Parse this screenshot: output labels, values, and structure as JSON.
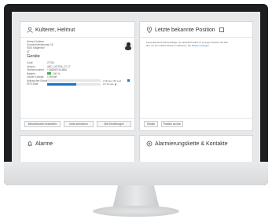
{
  "person_card": {
    "title": "Kulterer, Helmut",
    "address_lines": [
      "Helmut Kulterer",
      "Sonnenbuehlstrasse 18",
      "9020 Klagenfurt",
      "AT"
    ],
    "device_heading": "Geräte",
    "rows": [
      {
        "label": "Code",
        "value": "27780"
      },
      {
        "label": "Version",
        "value": "ABC-LX5TRA_27.17"
      },
      {
        "label": "Telefonnummer",
        "value": "+4368807344466"
      },
      {
        "label": "Batterie",
        "value": "100 %",
        "fill": 1.0
      },
      {
        "label": "Letzter Kontakt",
        "value": "1 Minute"
      },
      {
        "label": "Aktivsucher-Einstell.",
        "value": "2 Minuten (60 sec)",
        "fill": 0.75
      },
      {
        "label": "GPS-Rate",
        "value": "2/1 Stunde",
        "fill": 0.55
      }
    ],
    "buttons": [
      "Benutzerdaten bearbeiten",
      "Karte aufrufenen",
      "Alle Einstellungen"
    ]
  },
  "position_card": {
    "title": "Letzte bekannte Position",
    "text_line1": "Keine aktuelle Positionsanfrage. Um aktuelle Position zu erzeugen drücken Sie bitte",
    "text_line2": "hier, um den Tracker-Modus zu aktivieren. Sie",
    "link_text": "Position anzeigen",
    "buttons": [
      "Details",
      "Position suchen"
    ]
  },
  "alarm_card": {
    "title": "Alarme"
  },
  "chain_card": {
    "title": "Alarmierungskette & Kontakte"
  },
  "colors": {
    "accent": "#1a73c8",
    "battery": "#4caf50"
  }
}
